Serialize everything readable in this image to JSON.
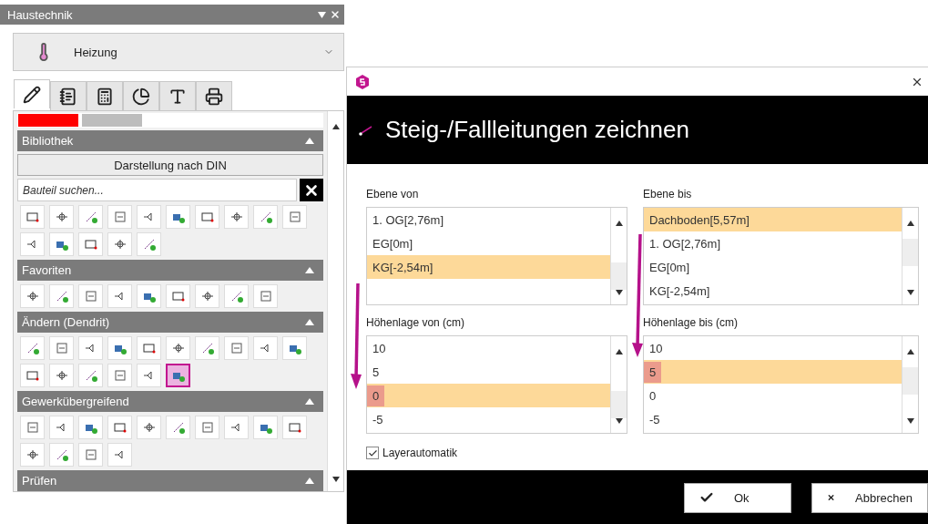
{
  "panel": {
    "title": "Haustechnik",
    "discipline": {
      "label": "Heizung"
    },
    "tabs": [
      {
        "selected": true
      },
      {
        "selected": false
      },
      {
        "selected": false
      },
      {
        "selected": false
      },
      {
        "selected": false
      },
      {
        "selected": false
      }
    ],
    "search": {
      "placeholder": "Bauteil suchen..."
    },
    "sections": [
      {
        "title": "Bibliothek",
        "expanded": true,
        "button": "Darstellung nach DIN",
        "tools": [
          {
            "selected": false
          },
          {
            "selected": false
          },
          {
            "selected": false
          },
          {
            "selected": false
          },
          {
            "selected": false
          },
          {
            "selected": false
          },
          {
            "selected": false
          },
          {
            "selected": false
          },
          {
            "selected": false
          },
          {
            "selected": false
          },
          {
            "selected": false
          },
          {
            "selected": false
          },
          {
            "selected": false
          },
          {
            "selected": false
          },
          {
            "selected": false
          }
        ]
      },
      {
        "title": "Favoriten",
        "expanded": true,
        "tools": [
          {
            "selected": false
          },
          {
            "selected": false
          },
          {
            "selected": false
          },
          {
            "selected": false
          },
          {
            "selected": false
          },
          {
            "selected": false
          },
          {
            "selected": false
          },
          {
            "selected": false
          },
          {
            "selected": false
          }
        ]
      },
      {
        "title": "Ändern (Dendrit)",
        "expanded": true,
        "tools": [
          {
            "selected": false
          },
          {
            "selected": false
          },
          {
            "selected": false
          },
          {
            "selected": false
          },
          {
            "selected": false
          },
          {
            "selected": false
          },
          {
            "selected": false
          },
          {
            "selected": false
          },
          {
            "selected": false
          },
          {
            "selected": false
          },
          {
            "selected": false
          },
          {
            "selected": false
          },
          {
            "selected": false
          },
          {
            "selected": false
          },
          {
            "selected": false
          },
          {
            "selected": true
          }
        ]
      },
      {
        "title": "Gewerkübergreifend",
        "expanded": true,
        "tools": [
          {
            "selected": false
          },
          {
            "selected": false
          },
          {
            "selected": false
          },
          {
            "selected": false
          },
          {
            "selected": false
          },
          {
            "selected": false
          },
          {
            "selected": false
          },
          {
            "selected": false
          },
          {
            "selected": false
          },
          {
            "selected": false
          },
          {
            "selected": false
          },
          {
            "selected": false
          },
          {
            "selected": false
          },
          {
            "selected": false
          }
        ]
      },
      {
        "title": "Prüfen",
        "expanded": true
      }
    ]
  },
  "dialog": {
    "title": "Steig-/Fallleitungen zeichnen",
    "lists": [
      {
        "label": "Ebene von",
        "items": [
          {
            "text": "1. OG[2,76m]",
            "selected": false
          },
          {
            "text": "EG[0m]",
            "selected": false
          },
          {
            "text": "KG[-2,54m]",
            "selected": true
          }
        ]
      },
      {
        "label": "Ebene bis",
        "items": [
          {
            "text": "Dachboden[5,57m]",
            "selected": true
          },
          {
            "text": "1. OG[2,76m]",
            "selected": false
          },
          {
            "text": "EG[0m]",
            "selected": false
          },
          {
            "text": "KG[-2,54m]",
            "selected": false
          }
        ]
      },
      {
        "label": "Höhenlage von (cm)",
        "items": [
          {
            "text": "10",
            "selected": false,
            "marked": false
          },
          {
            "text": "5",
            "selected": false,
            "marked": false
          },
          {
            "text": "0",
            "selected": true,
            "marked": true
          },
          {
            "text": "-5",
            "selected": false,
            "marked": false
          }
        ]
      },
      {
        "label": "Höhenlage bis (cm)",
        "items": [
          {
            "text": "10",
            "selected": false,
            "marked": false
          },
          {
            "text": "5",
            "selected": true,
            "marked": true
          },
          {
            "text": "0",
            "selected": false,
            "marked": false
          },
          {
            "text": "-5",
            "selected": false,
            "marked": false
          }
        ]
      }
    ],
    "layer_auto": {
      "label": "Layerautomatik",
      "checked": true
    },
    "buttons": [
      {
        "kind": "ok",
        "label": "Ok"
      },
      {
        "kind": "cancel",
        "label": "Abbrechen"
      }
    ]
  }
}
